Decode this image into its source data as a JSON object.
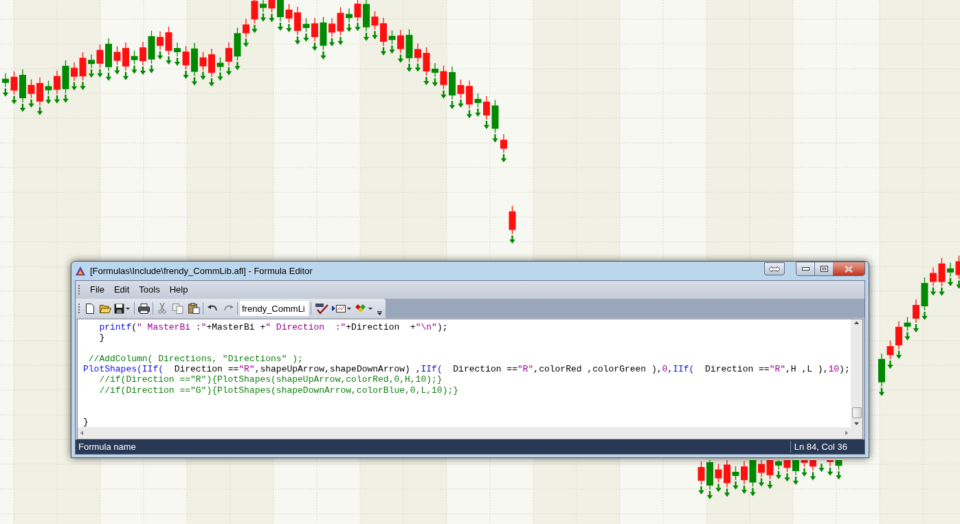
{
  "window": {
    "title": "[Formulas\\Include\\frendy_CommLib.afl] - Formula Editor",
    "menu": [
      "File",
      "Edit",
      "Tools",
      "Help"
    ],
    "formula_name": "frendy_CommLi"
  },
  "code_lines": [
    {
      "kind": "code",
      "indented": true,
      "tokens": [
        {
          "kind": "function",
          "text": "printf"
        },
        {
          "kind": "plain",
          "text": "("
        },
        {
          "kind": "string",
          "text": "\" MasterBi :\""
        },
        {
          "kind": "plain",
          "text": "+MasterBi +"
        },
        {
          "kind": "string",
          "text": "\" Direction  :\""
        },
        {
          "kind": "plain",
          "text": "+Direction  +"
        },
        {
          "kind": "string",
          "text": "\"\\n\""
        },
        {
          "kind": "plain",
          "text": ");"
        }
      ]
    },
    {
      "kind": "code",
      "indented": true,
      "tokens": [
        {
          "kind": "plain",
          "text": "}"
        }
      ]
    },
    {
      "kind": "blank"
    },
    {
      "kind": "code",
      "indented": false,
      "tokens": [
        {
          "kind": "comment",
          "text": " //AddColumn( Directions, \"Directions\" );"
        }
      ]
    },
    {
      "kind": "code",
      "indented": false,
      "tokens": [
        {
          "kind": "function",
          "text": "PlotShapes(IIf("
        },
        {
          "kind": "plain",
          "text": "  Direction =="
        },
        {
          "kind": "string",
          "text": "\"R\""
        },
        {
          "kind": "plain",
          "text": ",shapeUpArrow,shapeDownArrow) ,"
        },
        {
          "kind": "function",
          "text": "IIf("
        },
        {
          "kind": "plain",
          "text": "  Direction =="
        },
        {
          "kind": "string",
          "text": "\"R\""
        },
        {
          "kind": "plain",
          "text": ",colorRed ,colorGreen ),"
        },
        {
          "kind": "number",
          "text": "0"
        },
        {
          "kind": "plain",
          "text": ","
        },
        {
          "kind": "function",
          "text": "IIf("
        },
        {
          "kind": "plain",
          "text": "  Direction =="
        },
        {
          "kind": "string",
          "text": "\"R\""
        },
        {
          "kind": "plain",
          "text": ",H ,L ),"
        },
        {
          "kind": "number",
          "text": "10"
        },
        {
          "kind": "plain",
          "text": ");"
        }
      ]
    },
    {
      "kind": "code",
      "indented": true,
      "tokens": [
        {
          "kind": "comment",
          "text": "//if(Direction ==\"R\"){PlotShapes(shapeUpArrow,colorRed,0,H,10);}"
        }
      ]
    },
    {
      "kind": "code",
      "indented": true,
      "tokens": [
        {
          "kind": "comment",
          "text": "//if(Direction ==\"G\"){PlotShapes(shapeDownArrow,colorBlue,0,L,10);}"
        }
      ]
    },
    {
      "kind": "blank"
    },
    {
      "kind": "blank"
    },
    {
      "kind": "code",
      "indented": false,
      "tokens": [
        {
          "kind": "plain",
          "text": "}"
        }
      ]
    }
  ],
  "status_bar": {
    "label": "Formula name",
    "position": "Ln 84, Col 36"
  }
}
